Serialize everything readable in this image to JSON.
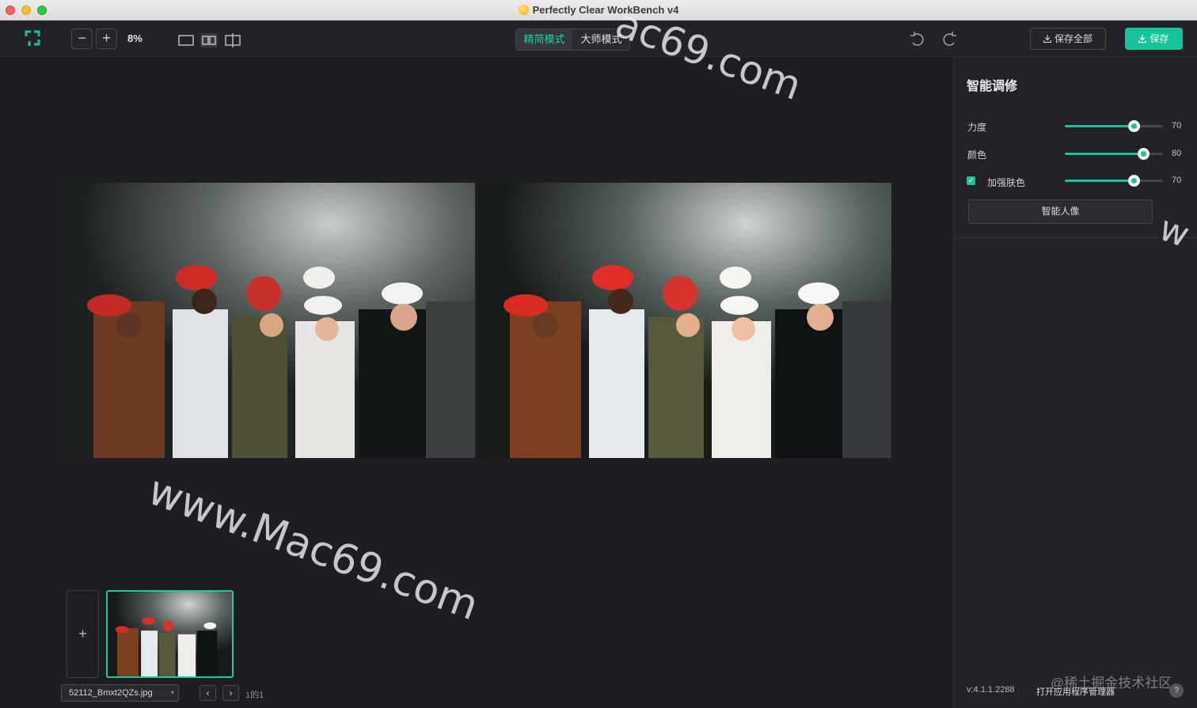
{
  "window": {
    "title": "Perfectly Clear WorkBench v4"
  },
  "toolbar": {
    "zoom_out_label": "−",
    "zoom_in_label": "+",
    "zoom_level": "8%",
    "mode_simple": "精简模式",
    "mode_master": "大师模式",
    "save_all_label": "保存全部",
    "save_label": "保存"
  },
  "panel": {
    "title": "智能调修",
    "sliders": [
      {
        "label": "力度",
        "value": 70,
        "display": "70"
      },
      {
        "label": "颜色",
        "value": 80,
        "display": "80"
      },
      {
        "label": "加强肤色",
        "value": 70,
        "display": "70",
        "checked": true
      }
    ],
    "smart_portrait_label": "智能人像",
    "version": "v:4.1.1.2288",
    "open_manager_label": "打开应用程序管理器",
    "help_label": "?"
  },
  "filmstrip": {
    "add_label": "+",
    "file_name": "52112_Bmxt2QZs.jpg",
    "prev_label": "‹",
    "next_label": "›",
    "page_count": "1的1"
  },
  "watermarks": {
    "main": "www.Mac69.com",
    "top": "ac69.com",
    "right": "w",
    "juejin": "@稀土掘金技术社区"
  },
  "colors": {
    "accent": "#16c39b",
    "background": "#1e1d22",
    "panel": "#232228"
  }
}
